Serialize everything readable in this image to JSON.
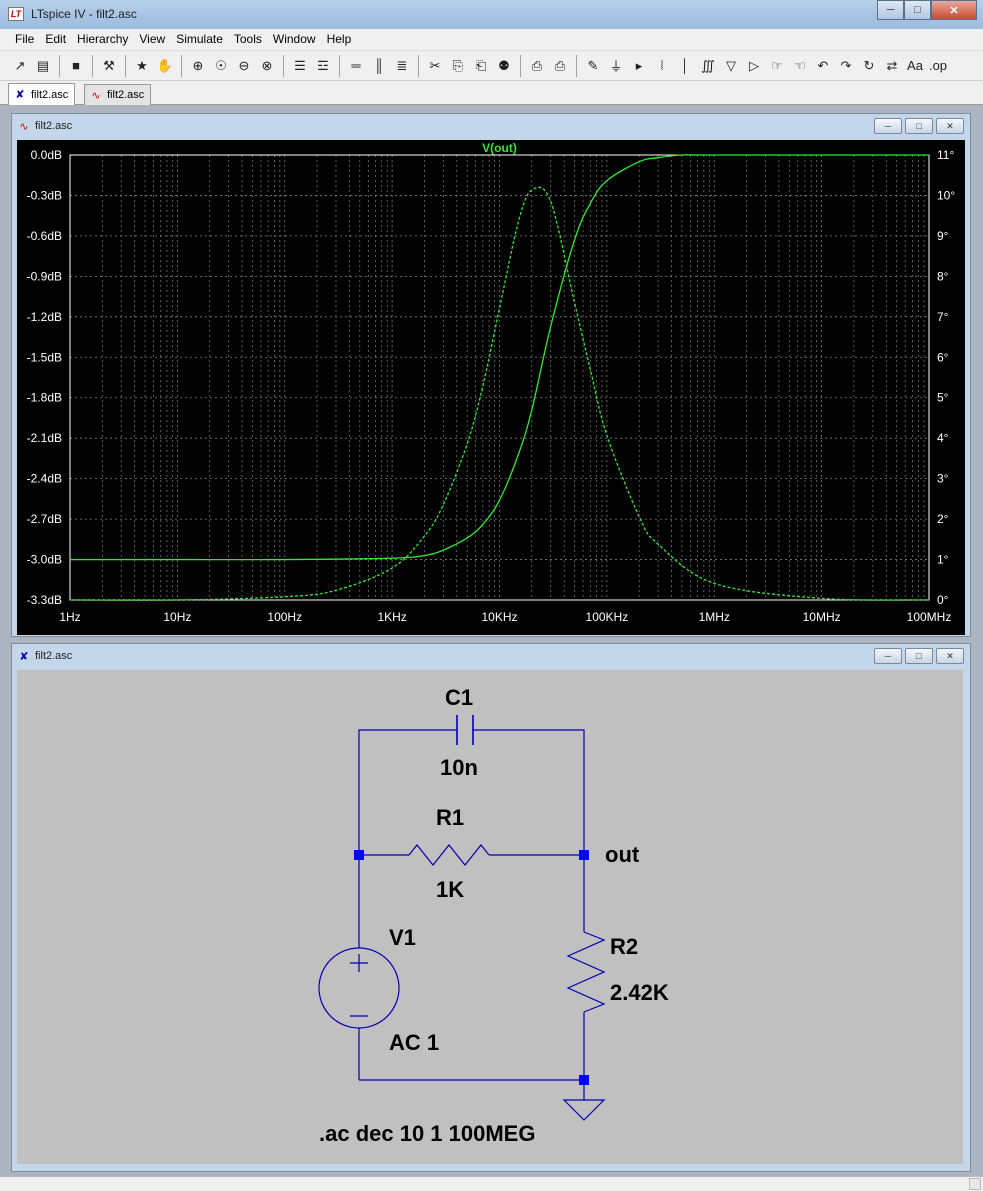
{
  "app": {
    "title": "LTspice IV - filt2.asc",
    "logo_text": "LT",
    "window_buttons": {
      "minimize": "─",
      "maximize": "□",
      "close": "✕"
    }
  },
  "menu": [
    "File",
    "Edit",
    "Hierarchy",
    "View",
    "Simulate",
    "Tools",
    "Window",
    "Help"
  ],
  "toolbar": [
    {
      "icon": "schematic-new-icon",
      "glyph": "↗"
    },
    {
      "icon": "open-folder-icon",
      "glyph": "▤"
    },
    {
      "sep": true
    },
    {
      "icon": "save-icon",
      "glyph": "■"
    },
    {
      "sep": true
    },
    {
      "icon": "control-panel-hammer-icon",
      "glyph": "⚒"
    },
    {
      "sep": true
    },
    {
      "icon": "run-icon",
      "glyph": "★"
    },
    {
      "icon": "halt-hand-icon",
      "glyph": "✋"
    },
    {
      "sep": true
    },
    {
      "icon": "zoom-in-icon",
      "glyph": "⊕"
    },
    {
      "icon": "pan-icon",
      "glyph": "☉"
    },
    {
      "icon": "zoom-out-icon",
      "glyph": "⊖"
    },
    {
      "icon": "zoom-fit-icon",
      "glyph": "⊗"
    },
    {
      "sep": true
    },
    {
      "icon": "autorange-icon",
      "glyph": "☰"
    },
    {
      "icon": "waveform-icon",
      "glyph": "☲"
    },
    {
      "sep": true
    },
    {
      "icon": "tile-horizontal-icon",
      "glyph": "═"
    },
    {
      "icon": "tile-vertical-icon",
      "glyph": "║"
    },
    {
      "icon": "cascade-icon",
      "glyph": "≣"
    },
    {
      "sep": true
    },
    {
      "icon": "cut-icon",
      "glyph": "✂"
    },
    {
      "icon": "copy-icon",
      "glyph": "⎘"
    },
    {
      "icon": "paste-icon",
      "glyph": "⎗"
    },
    {
      "icon": "find-binoculars-icon",
      "glyph": "⚉"
    },
    {
      "sep": true
    },
    {
      "icon": "print-preview-icon",
      "glyph": "⎙"
    },
    {
      "icon": "print-icon",
      "glyph": "⎙"
    },
    {
      "sep": true
    },
    {
      "icon": "draw-wire-icon",
      "glyph": "✎"
    },
    {
      "icon": "ground-icon",
      "glyph": "⏚"
    },
    {
      "icon": "label-net-icon",
      "glyph": "▸"
    },
    {
      "icon": "resistor-icon",
      "glyph": "⦚"
    },
    {
      "icon": "capacitor-icon",
      "glyph": "│"
    },
    {
      "icon": "inductor-icon",
      "glyph": "∭"
    },
    {
      "icon": "diode-icon",
      "glyph": "▽"
    },
    {
      "icon": "component-icon",
      "glyph": "▷"
    },
    {
      "icon": "move-hand-icon",
      "glyph": "☞"
    },
    {
      "icon": "drag-hand-icon",
      "glyph": "☜"
    },
    {
      "icon": "undo-icon",
      "glyph": "↶"
    },
    {
      "icon": "redo-icon",
      "glyph": "↷"
    },
    {
      "icon": "rotate-icon",
      "glyph": "↻"
    },
    {
      "icon": "mirror-icon",
      "glyph": "⇄"
    },
    {
      "icon": "text-icon",
      "glyph": "Aa"
    },
    {
      "icon": "spice-directive-icon",
      "glyph": ".op"
    }
  ],
  "tabs": [
    {
      "label": "filt2.asc",
      "icon": "schematic-icon",
      "active": true
    },
    {
      "label": "filt2.asc",
      "icon": "waveform-icon",
      "active": false
    }
  ],
  "plot_window": {
    "title": "filt2.asc",
    "trace_label": "V(out)",
    "trace_color": "#32e832",
    "background": "#000000",
    "grid_color": "#808080"
  },
  "chart_data": {
    "type": "line",
    "title": "V(out)",
    "x_scale": "log",
    "x_ticks": [
      "1Hz",
      "10Hz",
      "100Hz",
      "1KHz",
      "10KHz",
      "100KHz",
      "1MHz",
      "10MHz",
      "100MHz"
    ],
    "x_range_hz": [
      1,
      100000000
    ],
    "y_left_ticks": [
      "0.0dB",
      "-0.3dB",
      "-0.6dB",
      "-0.9dB",
      "-1.2dB",
      "-1.5dB",
      "-1.8dB",
      "-2.1dB",
      "-2.4dB",
      "-2.7dB",
      "-3.0dB",
      "-3.3dB"
    ],
    "y_left_range_db": [
      -3.3,
      0.0
    ],
    "y_right_ticks": [
      "11°",
      "10°",
      "9°",
      "8°",
      "7°",
      "6°",
      "5°",
      "4°",
      "3°",
      "2°",
      "1°",
      "0°"
    ],
    "y_right_range_deg": [
      0,
      11
    ],
    "grid": true,
    "series": [
      {
        "name": "magnitude",
        "style": "solid",
        "axis": "left",
        "x_hz": [
          1,
          10,
          100,
          1000,
          2000,
          3000,
          5000,
          7000,
          10000,
          15000,
          20000,
          30000,
          50000,
          70000,
          100000,
          200000,
          300000,
          500000,
          1000000,
          100000000
        ],
        "values_db": [
          -3.0,
          -3.0,
          -3.0,
          -2.99,
          -2.97,
          -2.93,
          -2.84,
          -2.74,
          -2.56,
          -2.22,
          -1.89,
          -1.27,
          -0.63,
          -0.36,
          -0.19,
          -0.05,
          -0.02,
          0.0,
          0.0,
          0.0
        ]
      },
      {
        "name": "phase",
        "style": "dashed",
        "axis": "right",
        "x_hz": [
          1,
          10,
          100,
          300,
          1000,
          2000,
          3000,
          5000,
          7000,
          10000,
          15000,
          20000,
          30000,
          50000,
          70000,
          100000,
          200000,
          300000,
          1000000,
          10000000,
          100000000
        ],
        "values_deg": [
          0.0,
          0.0,
          0.08,
          0.24,
          0.79,
          1.58,
          2.36,
          3.86,
          5.29,
          7.21,
          9.35,
          10.13,
          9.85,
          7.35,
          5.71,
          4.07,
          2.06,
          1.38,
          0.41,
          0.04,
          0.0
        ]
      }
    ]
  },
  "schematic_window": {
    "title": "filt2.asc",
    "background": "#c0c0c0",
    "wire_color": "#0000b4",
    "components": {
      "c1": {
        "name": "C1",
        "value": "10n"
      },
      "r1": {
        "name": "R1",
        "value": "1K"
      },
      "r2": {
        "name": "R2",
        "value": "2.42K"
      },
      "v1": {
        "name": "V1",
        "value": "AC 1"
      }
    },
    "net_label": "out",
    "directive": ".ac dec 10 1 100MEG"
  }
}
